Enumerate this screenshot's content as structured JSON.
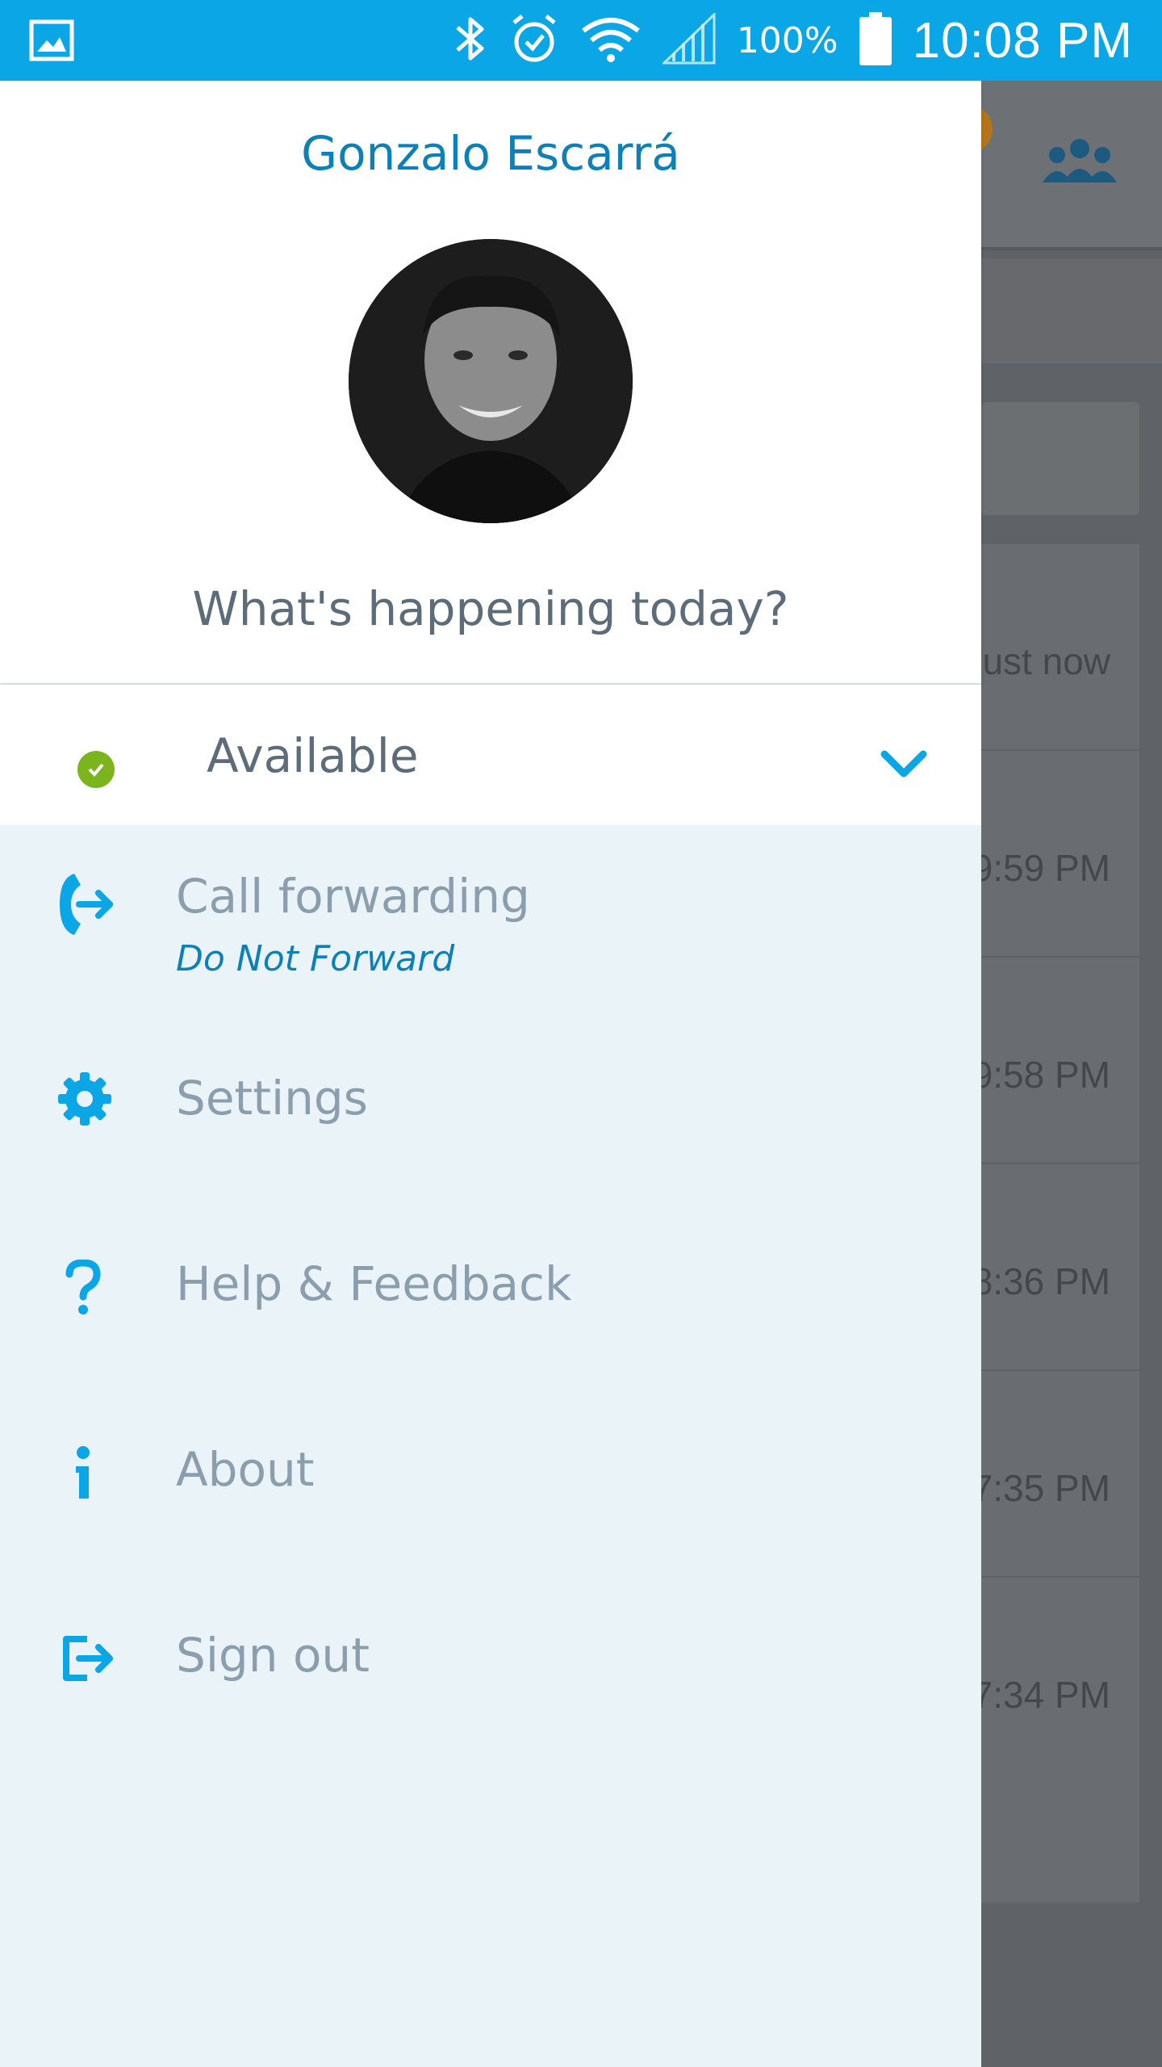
{
  "status_bar": {
    "battery_percent": "100%",
    "time": "10:08 PM",
    "icons": [
      "gallery-icon",
      "bluetooth-icon",
      "alarm-icon",
      "wifi-icon",
      "signal-icon",
      "battery-icon"
    ]
  },
  "background": {
    "times": [
      "ust now",
      "9:59 PM",
      "9:58 PM",
      "8:36 PM",
      "7:35 PM",
      "7:34 PM"
    ]
  },
  "drawer": {
    "profile": {
      "name": "Gonzalo Escarrá",
      "status_message": "What's happening today?"
    },
    "availability": {
      "label": "Available",
      "status_color": "#7ab51d"
    },
    "menu": [
      {
        "label": "Call forwarding",
        "sublabel": "Do Not Forward",
        "icon": "call-forwarding-icon"
      },
      {
        "label": "Settings",
        "icon": "gear-icon"
      },
      {
        "label": "Help & Feedback",
        "icon": "help-icon"
      },
      {
        "label": "About",
        "icon": "info-icon"
      },
      {
        "label": "Sign out",
        "icon": "sign-out-icon"
      }
    ]
  },
  "colors": {
    "accent": "#0aa6e6",
    "name_blue": "#0d80b8",
    "drawer_bg": "#eaf3f8",
    "menu_text": "#8a9eae"
  }
}
